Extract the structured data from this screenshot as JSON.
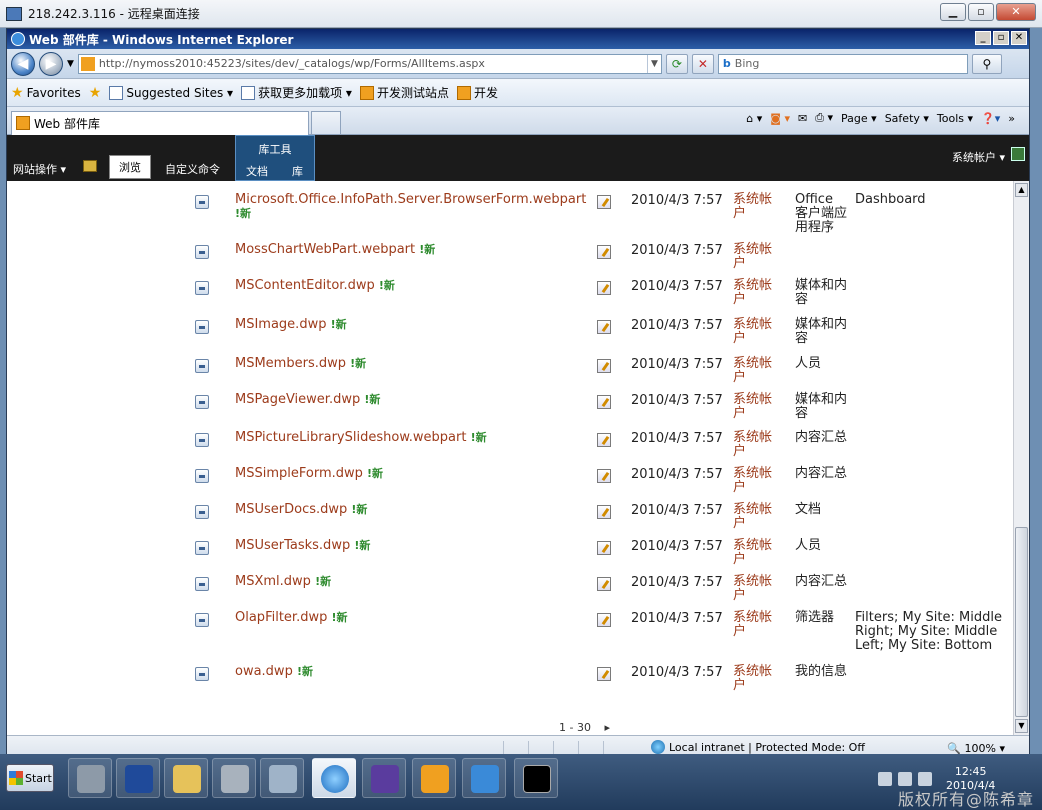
{
  "rdp": {
    "title": "218.242.3.116 - 远程桌面连接"
  },
  "browser": {
    "title": "Web 部件库 - Windows Internet Explorer",
    "url": "http://nymoss2010:45223/sites/dev/_catalogs/wp/Forms/AllItems.aspx",
    "search_placeholder": "Bing",
    "favorites_label": "Favorites",
    "fav_items": [
      "Suggested Sites ▾",
      "获取更多加载项 ▾",
      "开发测试站点",
      "开发"
    ],
    "tab_title": "Web 部件库",
    "commands": [
      "Page ▾",
      "Safety ▾",
      "Tools ▾"
    ]
  },
  "ribbon": {
    "site_actions": "网站操作 ▾",
    "browse": "浏览",
    "customize": "自定义命令",
    "lib_tools": "库工具",
    "doc_tab": "文档",
    "lib_tab": "库",
    "account": "系统帐户 ▾"
  },
  "rows": [
    {
      "name": "Microsoft.Office.InfoPath.Server.BrowserForm.webpart",
      "date": "2010/4/3 7:57",
      "user": "系统帐户",
      "group": "Office 客户端应用程序",
      "gallery": "Dashboard"
    },
    {
      "name": "MossChartWebPart.webpart",
      "date": "2010/4/3 7:57",
      "user": "系统帐户",
      "group": "",
      "gallery": ""
    },
    {
      "name": "MSContentEditor.dwp",
      "date": "2010/4/3 7:57",
      "user": "系统帐户",
      "group": "媒体和内容",
      "gallery": ""
    },
    {
      "name": "MSImage.dwp",
      "date": "2010/4/3 7:57",
      "user": "系统帐户",
      "group": "媒体和内容",
      "gallery": ""
    },
    {
      "name": "MSMembers.dwp",
      "date": "2010/4/3 7:57",
      "user": "系统帐户",
      "group": "人员",
      "gallery": ""
    },
    {
      "name": "MSPageViewer.dwp",
      "date": "2010/4/3 7:57",
      "user": "系统帐户",
      "group": "媒体和内容",
      "gallery": ""
    },
    {
      "name": "MSPictureLibrarySlideshow.webpart",
      "date": "2010/4/3 7:57",
      "user": "系统帐户",
      "group": "内容汇总",
      "gallery": ""
    },
    {
      "name": "MSSimpleForm.dwp",
      "date": "2010/4/3 7:57",
      "user": "系统帐户",
      "group": "内容汇总",
      "gallery": ""
    },
    {
      "name": "MSUserDocs.dwp",
      "date": "2010/4/3 7:57",
      "user": "系统帐户",
      "group": "文档",
      "gallery": ""
    },
    {
      "name": "MSUserTasks.dwp",
      "date": "2010/4/3 7:57",
      "user": "系统帐户",
      "group": "人员",
      "gallery": ""
    },
    {
      "name": "MSXml.dwp",
      "date": "2010/4/3 7:57",
      "user": "系统帐户",
      "group": "内容汇总",
      "gallery": ""
    },
    {
      "name": "OlapFilter.dwp",
      "date": "2010/4/3 7:57",
      "user": "系统帐户",
      "group": "筛选器",
      "gallery": "Filters; My Site: Middle Right; My Site: Middle Left; My Site: Bottom"
    },
    {
      "name": "owa.dwp",
      "date": "2010/4/3 7:57",
      "user": "系统帐户",
      "group": "我的信息",
      "gallery": ""
    }
  ],
  "new_label": "!新",
  "paging": "1 - 30",
  "status": {
    "zone": "Local intranet | Protected Mode: Off",
    "zoom": "100%"
  },
  "taskbar": {
    "start": "Start",
    "time": "12:45",
    "date": "2010/4/4"
  },
  "watermark": "版权所有@陈希章"
}
